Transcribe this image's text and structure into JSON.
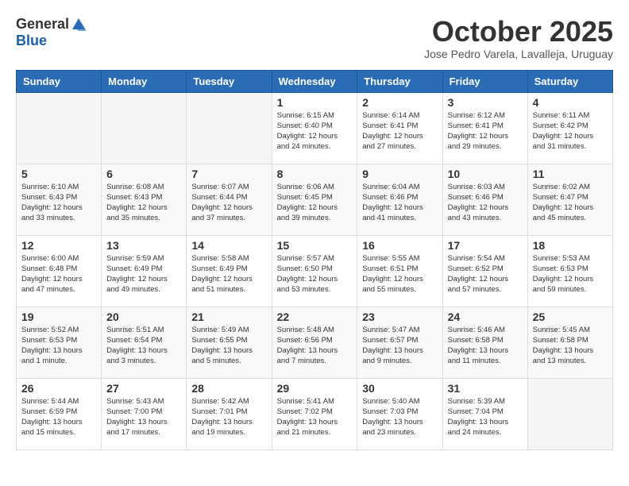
{
  "logo": {
    "general": "General",
    "blue": "Blue"
  },
  "header": {
    "month_year": "October 2025",
    "location": "Jose Pedro Varela, Lavalleja, Uruguay"
  },
  "weekdays": [
    "Sunday",
    "Monday",
    "Tuesday",
    "Wednesday",
    "Thursday",
    "Friday",
    "Saturday"
  ],
  "weeks": [
    [
      {
        "day": "",
        "info": ""
      },
      {
        "day": "",
        "info": ""
      },
      {
        "day": "",
        "info": ""
      },
      {
        "day": "1",
        "info": "Sunrise: 6:15 AM\nSunset: 6:40 PM\nDaylight: 12 hours\nand 24 minutes."
      },
      {
        "day": "2",
        "info": "Sunrise: 6:14 AM\nSunset: 6:41 PM\nDaylight: 12 hours\nand 27 minutes."
      },
      {
        "day": "3",
        "info": "Sunrise: 6:12 AM\nSunset: 6:41 PM\nDaylight: 12 hours\nand 29 minutes."
      },
      {
        "day": "4",
        "info": "Sunrise: 6:11 AM\nSunset: 6:42 PM\nDaylight: 12 hours\nand 31 minutes."
      }
    ],
    [
      {
        "day": "5",
        "info": "Sunrise: 6:10 AM\nSunset: 6:43 PM\nDaylight: 12 hours\nand 33 minutes."
      },
      {
        "day": "6",
        "info": "Sunrise: 6:08 AM\nSunset: 6:43 PM\nDaylight: 12 hours\nand 35 minutes."
      },
      {
        "day": "7",
        "info": "Sunrise: 6:07 AM\nSunset: 6:44 PM\nDaylight: 12 hours\nand 37 minutes."
      },
      {
        "day": "8",
        "info": "Sunrise: 6:06 AM\nSunset: 6:45 PM\nDaylight: 12 hours\nand 39 minutes."
      },
      {
        "day": "9",
        "info": "Sunrise: 6:04 AM\nSunset: 6:46 PM\nDaylight: 12 hours\nand 41 minutes."
      },
      {
        "day": "10",
        "info": "Sunrise: 6:03 AM\nSunset: 6:46 PM\nDaylight: 12 hours\nand 43 minutes."
      },
      {
        "day": "11",
        "info": "Sunrise: 6:02 AM\nSunset: 6:47 PM\nDaylight: 12 hours\nand 45 minutes."
      }
    ],
    [
      {
        "day": "12",
        "info": "Sunrise: 6:00 AM\nSunset: 6:48 PM\nDaylight: 12 hours\nand 47 minutes."
      },
      {
        "day": "13",
        "info": "Sunrise: 5:59 AM\nSunset: 6:49 PM\nDaylight: 12 hours\nand 49 minutes."
      },
      {
        "day": "14",
        "info": "Sunrise: 5:58 AM\nSunset: 6:49 PM\nDaylight: 12 hours\nand 51 minutes."
      },
      {
        "day": "15",
        "info": "Sunrise: 5:57 AM\nSunset: 6:50 PM\nDaylight: 12 hours\nand 53 minutes."
      },
      {
        "day": "16",
        "info": "Sunrise: 5:55 AM\nSunset: 6:51 PM\nDaylight: 12 hours\nand 55 minutes."
      },
      {
        "day": "17",
        "info": "Sunrise: 5:54 AM\nSunset: 6:52 PM\nDaylight: 12 hours\nand 57 minutes."
      },
      {
        "day": "18",
        "info": "Sunrise: 5:53 AM\nSunset: 6:53 PM\nDaylight: 12 hours\nand 59 minutes."
      }
    ],
    [
      {
        "day": "19",
        "info": "Sunrise: 5:52 AM\nSunset: 6:53 PM\nDaylight: 13 hours\nand 1 minute."
      },
      {
        "day": "20",
        "info": "Sunrise: 5:51 AM\nSunset: 6:54 PM\nDaylight: 13 hours\nand 3 minutes."
      },
      {
        "day": "21",
        "info": "Sunrise: 5:49 AM\nSunset: 6:55 PM\nDaylight: 13 hours\nand 5 minutes."
      },
      {
        "day": "22",
        "info": "Sunrise: 5:48 AM\nSunset: 6:56 PM\nDaylight: 13 hours\nand 7 minutes."
      },
      {
        "day": "23",
        "info": "Sunrise: 5:47 AM\nSunset: 6:57 PM\nDaylight: 13 hours\nand 9 minutes."
      },
      {
        "day": "24",
        "info": "Sunrise: 5:46 AM\nSunset: 6:58 PM\nDaylight: 13 hours\nand 11 minutes."
      },
      {
        "day": "25",
        "info": "Sunrise: 5:45 AM\nSunset: 6:58 PM\nDaylight: 13 hours\nand 13 minutes."
      }
    ],
    [
      {
        "day": "26",
        "info": "Sunrise: 5:44 AM\nSunset: 6:59 PM\nDaylight: 13 hours\nand 15 minutes."
      },
      {
        "day": "27",
        "info": "Sunrise: 5:43 AM\nSunset: 7:00 PM\nDaylight: 13 hours\nand 17 minutes."
      },
      {
        "day": "28",
        "info": "Sunrise: 5:42 AM\nSunset: 7:01 PM\nDaylight: 13 hours\nand 19 minutes."
      },
      {
        "day": "29",
        "info": "Sunrise: 5:41 AM\nSunset: 7:02 PM\nDaylight: 13 hours\nand 21 minutes."
      },
      {
        "day": "30",
        "info": "Sunrise: 5:40 AM\nSunset: 7:03 PM\nDaylight: 13 hours\nand 23 minutes."
      },
      {
        "day": "31",
        "info": "Sunrise: 5:39 AM\nSunset: 7:04 PM\nDaylight: 13 hours\nand 24 minutes."
      },
      {
        "day": "",
        "info": ""
      }
    ]
  ]
}
